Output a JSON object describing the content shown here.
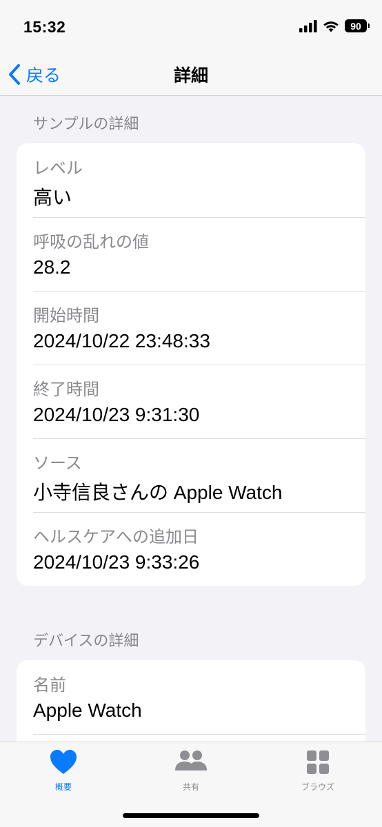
{
  "status_bar": {
    "time": "15:32",
    "battery": "90",
    "icons": [
      "cellular-signal-icon",
      "wifi-icon",
      "battery-icon"
    ]
  },
  "nav": {
    "back_label": "戻る",
    "title": "詳細"
  },
  "sample_section": {
    "header": "サンプルの詳細",
    "rows": [
      {
        "label": "レベル",
        "value": "高い"
      },
      {
        "label": "呼吸の乱れの値",
        "value": "28.2"
      },
      {
        "label": "開始時間",
        "value": "2024/10/22 23:48:33"
      },
      {
        "label": "終了時間",
        "value": "2024/10/23 9:31:30"
      },
      {
        "label": "ソース",
        "value": "小寺信良さんの Apple Watch"
      },
      {
        "label": "ヘルスケアへの追加日",
        "value": "2024/10/23 9:33:26"
      }
    ]
  },
  "device_section": {
    "header": "デバイスの詳細",
    "rows": [
      {
        "label": "名前",
        "value": "Apple Watch"
      }
    ]
  },
  "tab_bar": {
    "tabs": [
      {
        "label": "概要",
        "icon": "heart-icon",
        "active": true
      },
      {
        "label": "共有",
        "icon": "people-icon",
        "active": false
      },
      {
        "label": "ブラウズ",
        "icon": "grid-icon",
        "active": false
      }
    ]
  },
  "colors": {
    "accent": "#0a7aff",
    "background": "#f2f2f7",
    "secondary_text": "#8a8a8e"
  }
}
